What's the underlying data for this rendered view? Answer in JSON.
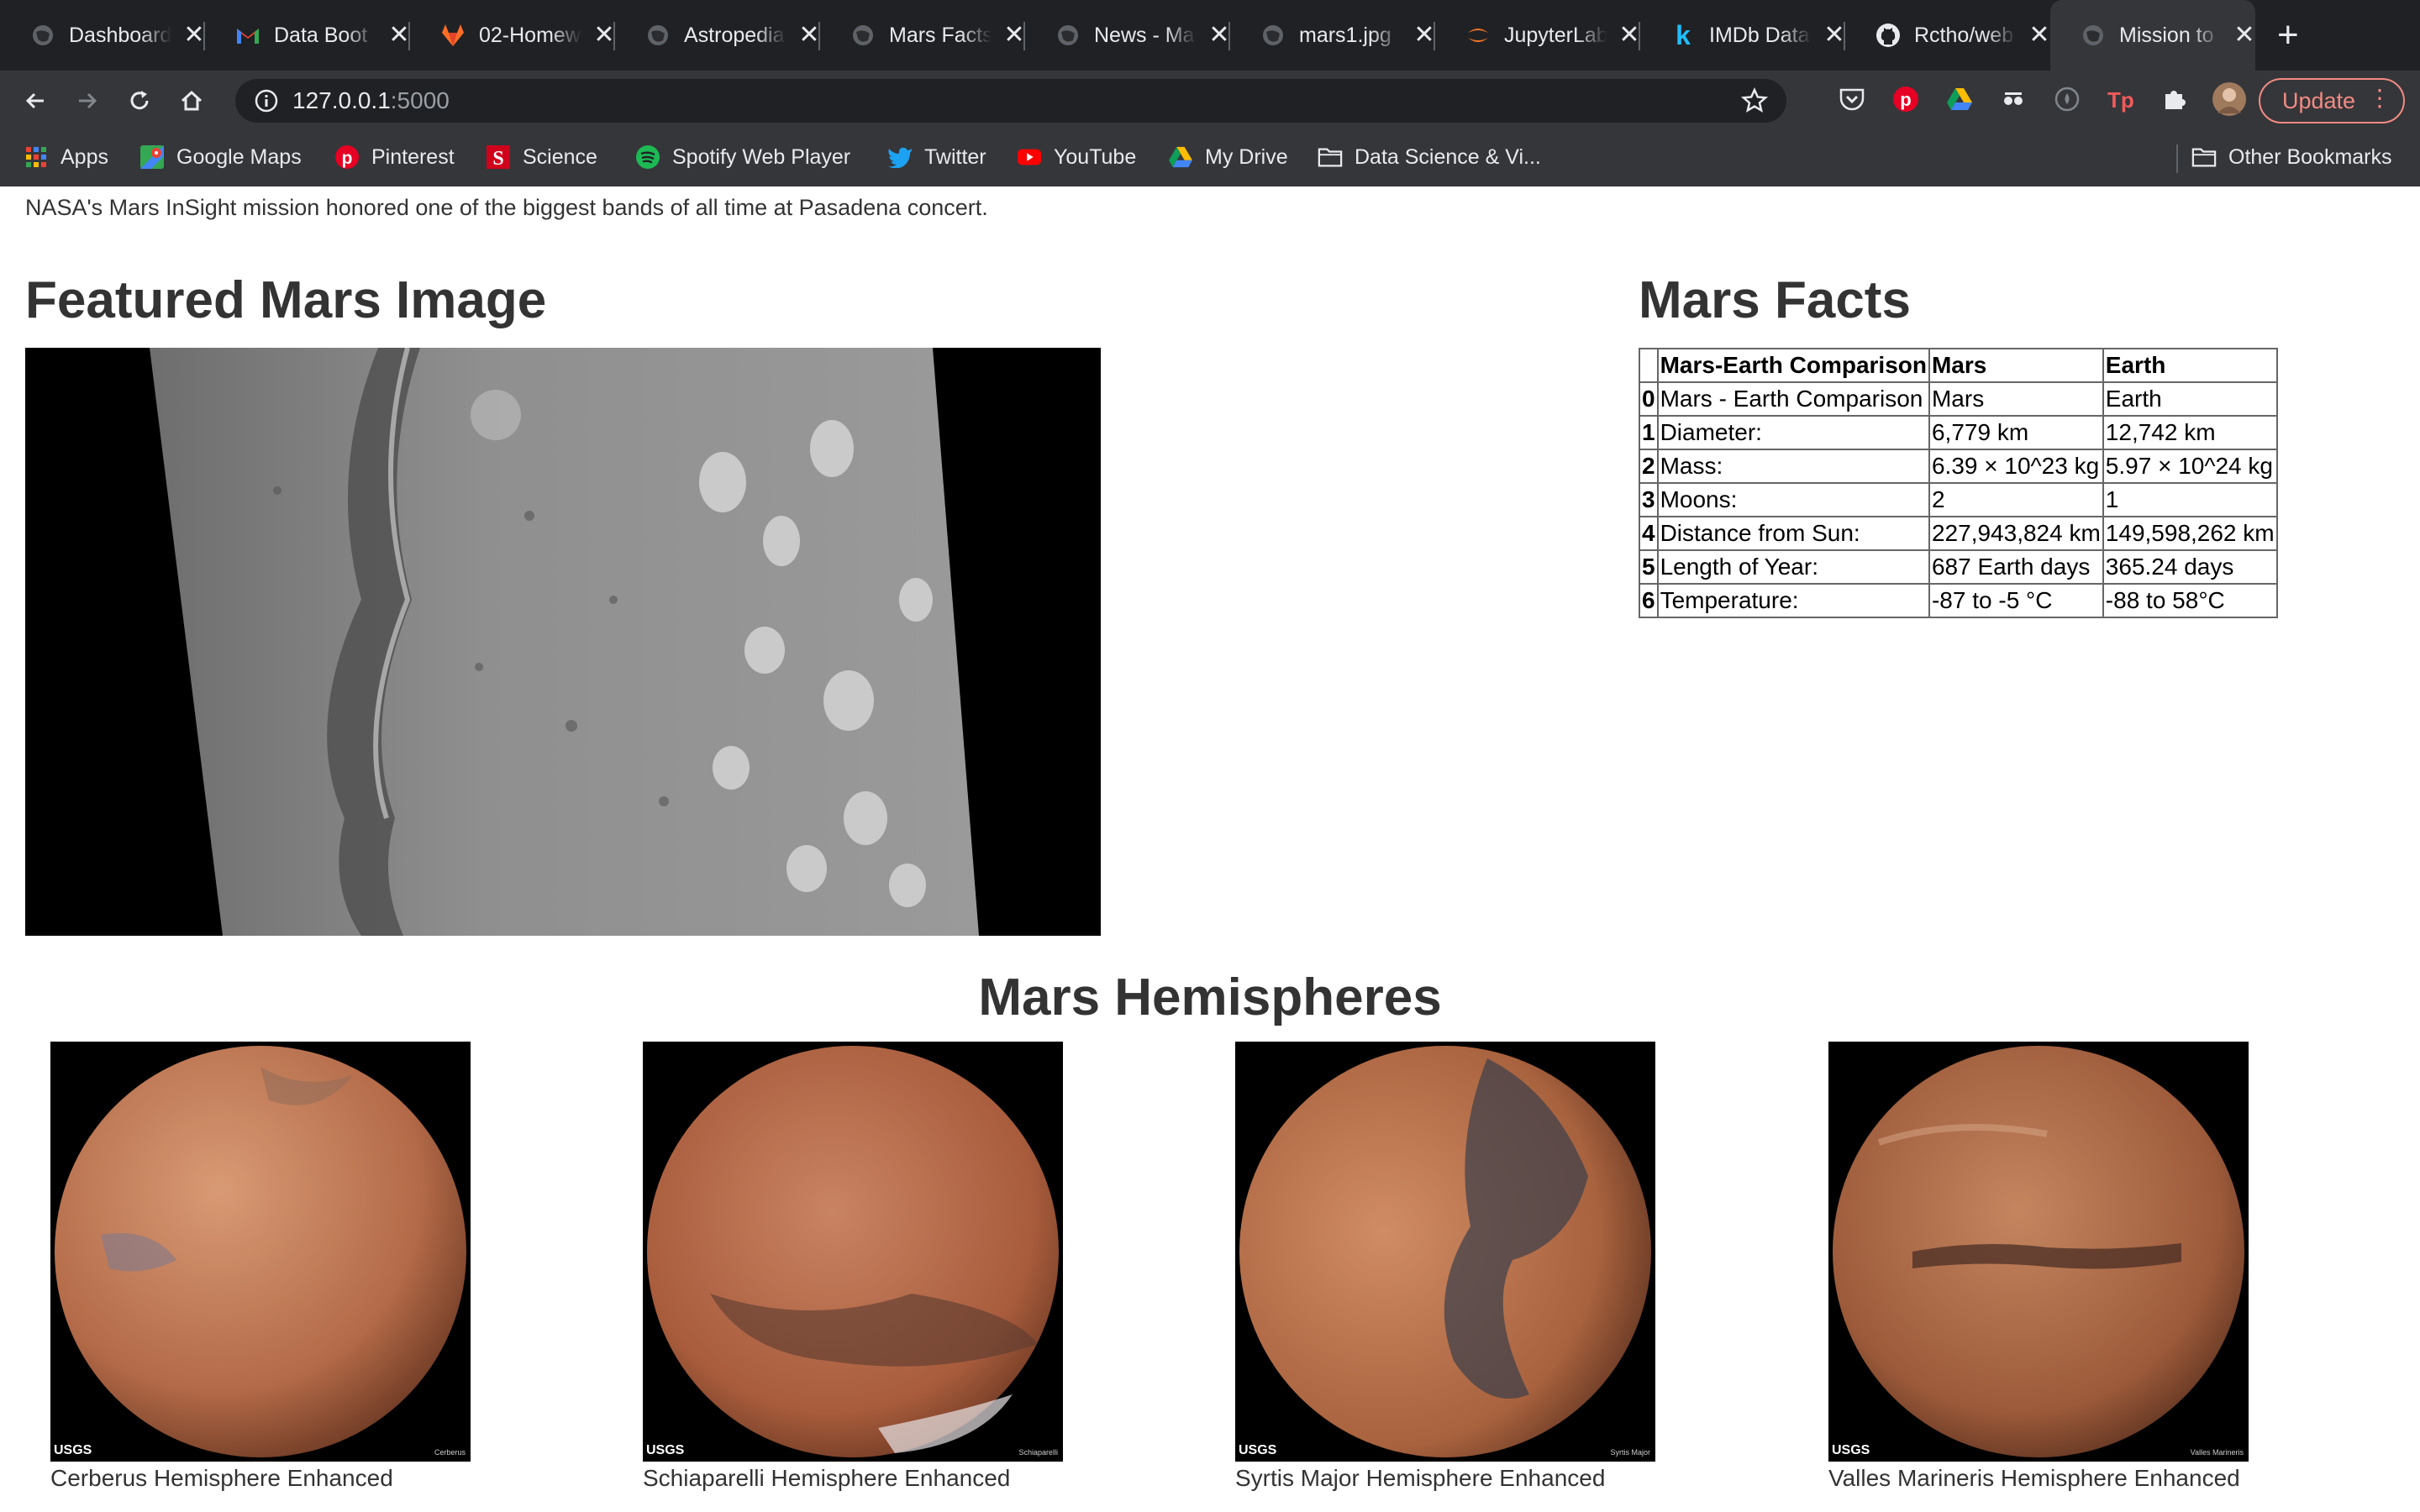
{
  "browser": {
    "tabs": [
      {
        "title": "Dashboard",
        "icon": "globe-icon"
      },
      {
        "title": "Data Boot",
        "icon": "gmail-icon"
      },
      {
        "title": "02-Homew",
        "icon": "gitlab-icon"
      },
      {
        "title": "Astropedia",
        "icon": "globe-icon"
      },
      {
        "title": "Mars Facts",
        "icon": "globe-icon"
      },
      {
        "title": "News - Mars",
        "icon": "globe-icon"
      },
      {
        "title": "mars1.jpg",
        "icon": "globe-icon"
      },
      {
        "title": "JupyterLab",
        "icon": "jupyter-icon"
      },
      {
        "title": "IMDb Data",
        "icon": "kaggle-icon"
      },
      {
        "title": "Rctho/web",
        "icon": "github-icon"
      },
      {
        "title": "Mission to",
        "icon": "globe-icon"
      }
    ],
    "address": {
      "host": "127.0.0.1",
      "port": ":5000"
    },
    "update_label": "Update",
    "bookmarks": [
      {
        "label": "Apps",
        "icon": "apps-grid-icon"
      },
      {
        "label": "Google Maps",
        "icon": "google-maps-icon"
      },
      {
        "label": "Pinterest",
        "icon": "pinterest-icon"
      },
      {
        "label": "Science",
        "icon": "science-icon"
      },
      {
        "label": "Spotify Web Player",
        "icon": "spotify-icon"
      },
      {
        "label": "Twitter",
        "icon": "twitter-icon"
      },
      {
        "label": "YouTube",
        "icon": "youtube-icon"
      },
      {
        "label": "My Drive",
        "icon": "google-drive-icon"
      },
      {
        "label": "Data Science & Vi...",
        "icon": "folder-icon"
      }
    ],
    "other_bookmarks": "Other Bookmarks"
  },
  "page": {
    "news_teaser": "NASA's Mars InSight mission honored one of the biggest bands of all time at Pasadena concert.",
    "featured_title": "Featured Mars Image",
    "facts_title": "Mars Facts",
    "facts_table": {
      "headers": [
        "",
        "Mars-Earth Comparison",
        "Mars",
        "Earth"
      ],
      "rows": [
        [
          "0",
          "Mars - Earth Comparison",
          "Mars",
          "Earth"
        ],
        [
          "1",
          "Diameter:",
          "6,779 km",
          "12,742 km"
        ],
        [
          "2",
          "Mass:",
          "6.39 × 10^23 kg",
          "5.97 × 10^24 kg"
        ],
        [
          "3",
          "Moons:",
          "2",
          "1"
        ],
        [
          "4",
          "Distance from Sun:",
          "227,943,824 km",
          "149,598,262 km"
        ],
        [
          "5",
          "Length of Year:",
          "687 Earth days",
          "365.24 days"
        ],
        [
          "6",
          "Temperature:",
          "-87 to -5 °C",
          "-88 to 58°C"
        ]
      ]
    },
    "hemispheres_title": "Mars Hemispheres",
    "hemispheres": [
      {
        "caption": "Cerberus Hemisphere Enhanced",
        "credit": "USGS",
        "label": "Cerberus"
      },
      {
        "caption": "Schiaparelli Hemisphere Enhanced",
        "credit": "USGS",
        "label": "Schiaparelli"
      },
      {
        "caption": "Syrtis Major Hemisphere Enhanced",
        "credit": "USGS",
        "label": "Syrtis Major"
      },
      {
        "caption": "Valles Marineris Hemisphere Enhanced",
        "credit": "USGS",
        "label": "Valles Marineris"
      }
    ]
  },
  "colors": {
    "chrome_dark": "#202124",
    "chrome_toolbar": "#35363a",
    "update_accent": "#f28b82",
    "mars_surface": "#c27a55"
  }
}
